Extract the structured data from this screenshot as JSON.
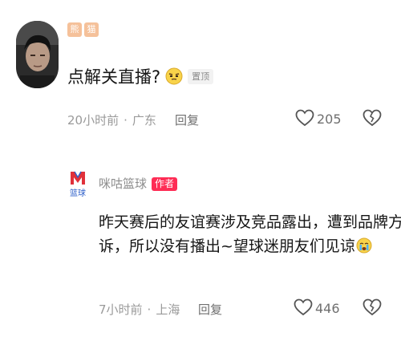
{
  "comment1": {
    "badges": [
      "熊",
      "猫"
    ],
    "text": "点解关直播?",
    "emoji": "smug-face-emoji",
    "pinned_label": "置顶",
    "time": "20小时前",
    "location": "广东",
    "reply_label": "回复",
    "likes": "205"
  },
  "comment2": {
    "author": "咪咕篮球",
    "author_tag": "作者",
    "avatar_label": "篮球",
    "text_line1": "昨天赛后的友谊赛涉及竞品露出，遭到品牌方投",
    "text_line2": "诉，所以没有播出~望球迷朋友们见谅",
    "emoji": "crying-face-emoji",
    "time": "7小时前",
    "location": "上海",
    "reply_label": "回复",
    "likes": "446"
  },
  "separator": "·",
  "colors": {
    "author_tag": "#fe2c55",
    "meta": "#9a9a9a",
    "badge": "#f5c19a"
  }
}
